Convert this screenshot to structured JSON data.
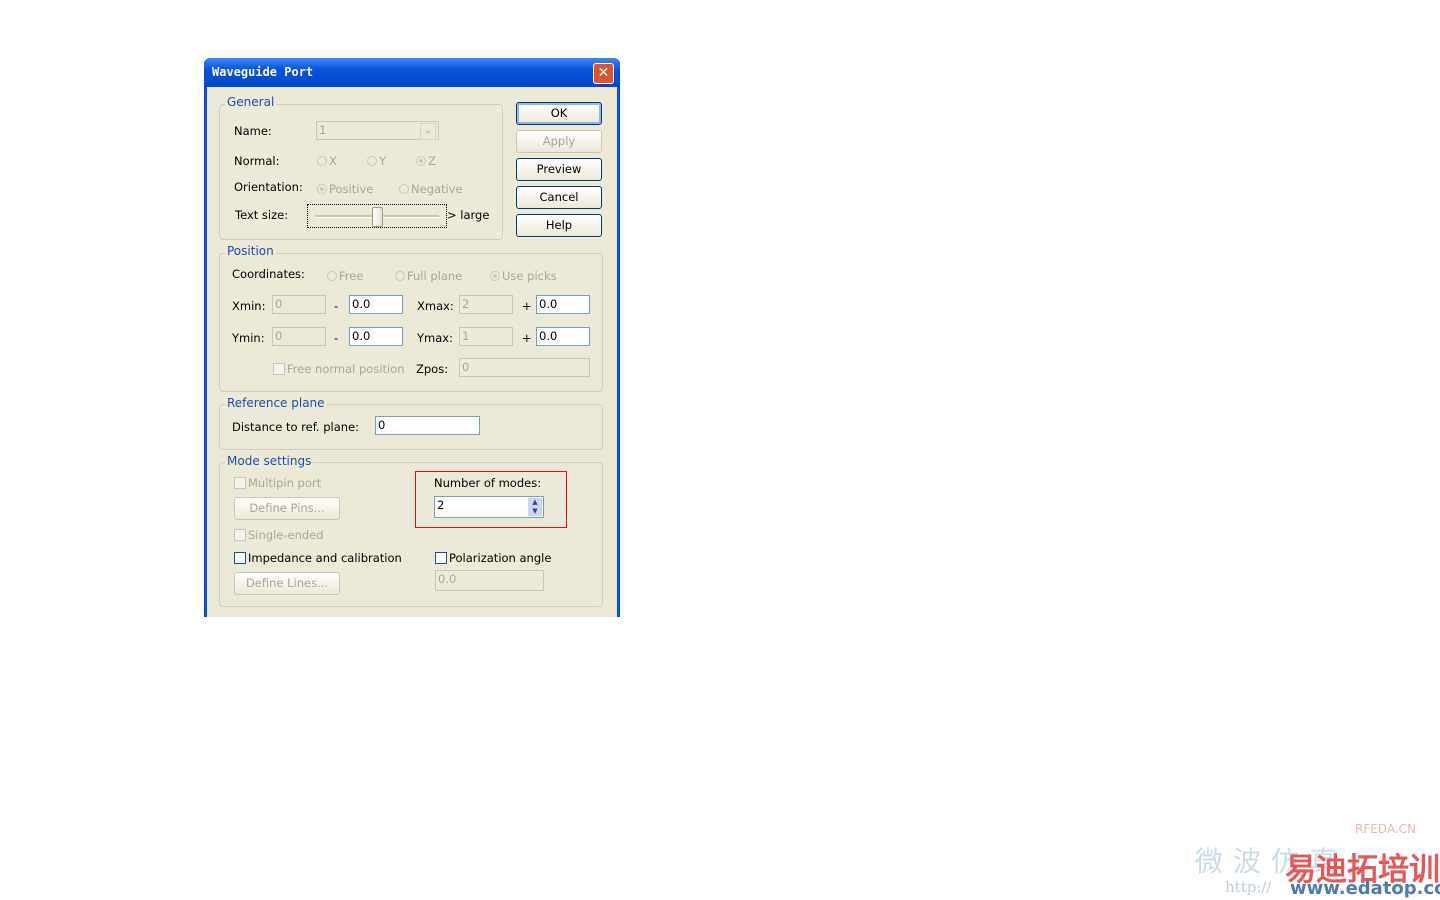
{
  "dialog": {
    "title": "Waveguide Port"
  },
  "buttons": {
    "ok": "OK",
    "apply": "Apply",
    "preview": "Preview",
    "cancel": "Cancel",
    "help": "Help"
  },
  "general": {
    "legend": "General",
    "name_label": "Name:",
    "name_value": "1",
    "normal_label": "Normal:",
    "normal_options": [
      "X",
      "Y",
      "Z"
    ],
    "normal_selected": "Z",
    "orientation_label": "Orientation:",
    "orientation_options": [
      "Positive",
      "Negative"
    ],
    "orientation_selected": "Positive",
    "text_size_label": "Text size:",
    "text_size_suffix": "> large",
    "text_size_level": 0.5
  },
  "position": {
    "legend": "Position",
    "coordinates_label": "Coordinates:",
    "coordinates_options": [
      "Free",
      "Full plane",
      "Use picks"
    ],
    "coordinates_selected": "Use picks",
    "xmin_label": "Xmin:",
    "xmin": "0",
    "xmin_offset": "0.0",
    "xmax_label": "Xmax:",
    "xmax": "2",
    "xmax_offset": "0.0",
    "ymin_label": "Ymin:",
    "ymin": "0",
    "ymin_offset": "0.0",
    "ymax_label": "Ymax:",
    "ymax": "1",
    "ymax_offset": "0.0",
    "minus": "-",
    "plus": "+",
    "free_normal_label": "Free normal position",
    "zpos_label": "Zpos:",
    "zpos": "0"
  },
  "reference": {
    "legend": "Reference plane",
    "distance_label": "Distance to ref. plane:",
    "distance": "0"
  },
  "mode": {
    "legend": "Mode settings",
    "multipin": "Multipin port",
    "define_pins": "Define Pins...",
    "single_ended": "Single-ended",
    "impedance": "Impedance and calibration",
    "define_lines": "Define Lines...",
    "num_modes_label": "Number of modes:",
    "num_modes": "2",
    "polarization": "Polarization angle",
    "polarization_value": "0.0"
  },
  "watermark": {
    "site": "RFEDA.CN",
    "brand": "易迪拓培训",
    "url": "www.edatop.com",
    "http": "http://",
    "cn": "微波仿真"
  }
}
